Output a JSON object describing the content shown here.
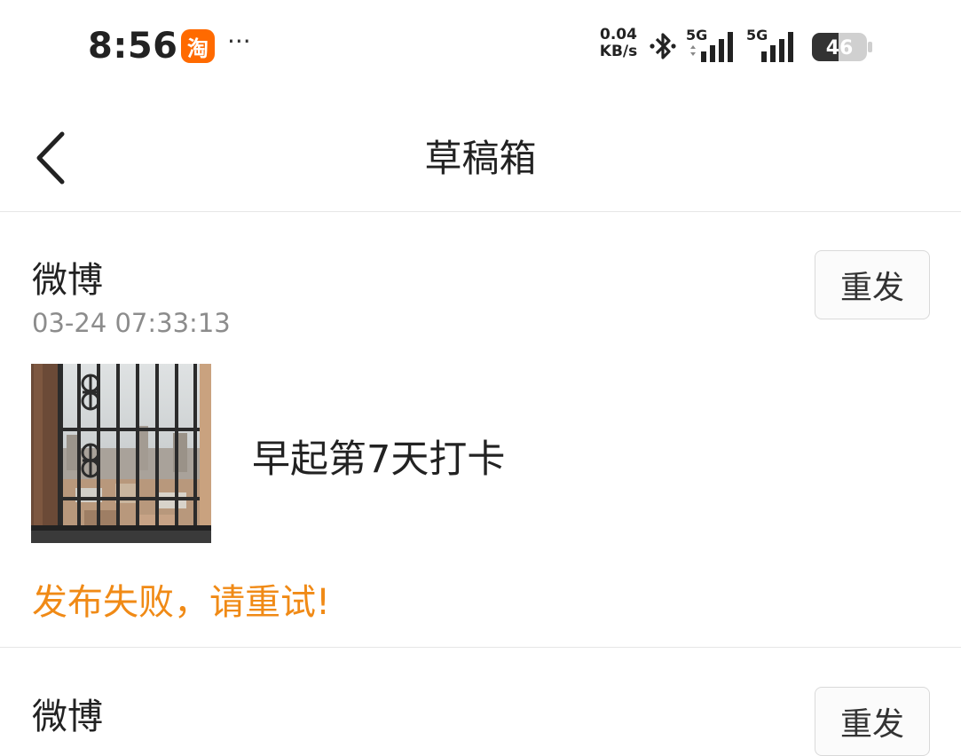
{
  "status_bar": {
    "time": "8:56",
    "app_notice_icon": "taobao-icon",
    "app_notice_glyph": "淘",
    "more_notifications": "···",
    "net_speed_value": "0.04",
    "net_speed_unit": "KB/s",
    "network_1": "5G",
    "network_2": "5G",
    "battery_level": "46"
  },
  "nav": {
    "back_icon": "chevron-left-icon",
    "title": "草稿箱"
  },
  "drafts": [
    {
      "source": "微博",
      "timestamp": "03-24 07:33:13",
      "resend_label": "重发",
      "content": "早起第7天打卡",
      "error": "发布失败，请重试!",
      "thumbnail": "balcony-window-city-view-photo"
    },
    {
      "source": "微博",
      "resend_label": "重发"
    }
  ],
  "colors": {
    "error_text": "#f08a16",
    "taobao_brand": "#ff6a00",
    "timestamp_text": "#8c8c8c",
    "divider": "#e6e6e6"
  }
}
